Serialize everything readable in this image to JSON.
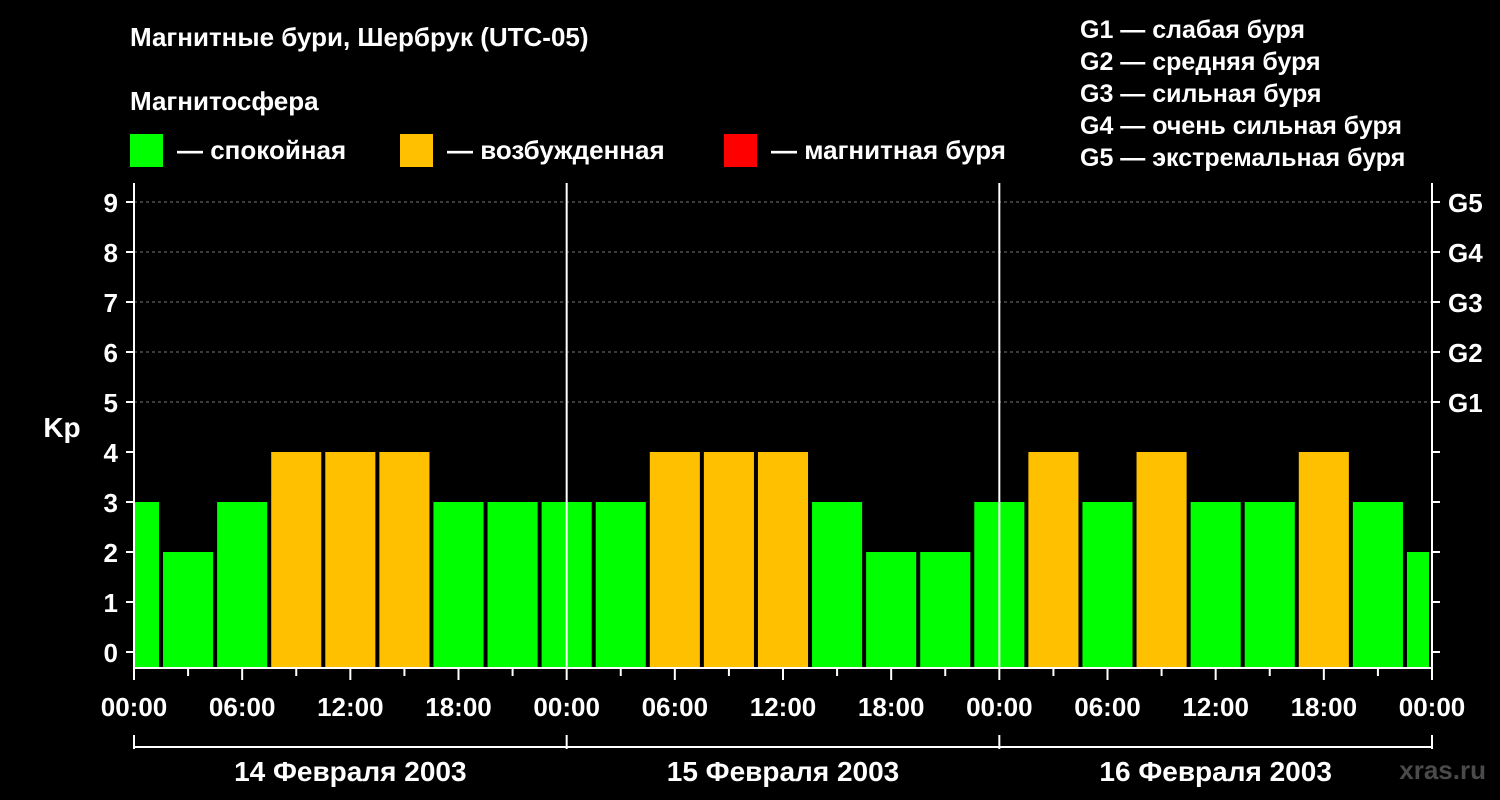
{
  "title": "Магнитные бури, Шербрук (UTC-05)",
  "magnetosphere": {
    "heading": "Магнитосфера",
    "legend": [
      {
        "label": "— спокойная",
        "color": "#00ff00"
      },
      {
        "label": "— возбужденная",
        "color": "#ffc000"
      },
      {
        "label": "— магнитная буря",
        "color": "#ff0000"
      }
    ]
  },
  "g_legend": [
    "G1 — слабая буря",
    "G2 — средняя буря",
    "G3 — сильная буря",
    "G4 — очень сильная буря",
    "G5 — экстремальная буря"
  ],
  "watermark": "xras.ru",
  "chart_data": {
    "type": "bar",
    "ylabel": "Kp",
    "ylim": [
      0,
      9
    ],
    "yticks": [
      "0",
      "1",
      "2",
      "3",
      "4",
      "5",
      "6",
      "7",
      "8",
      "9"
    ],
    "g_levels": [
      {
        "label": "G1",
        "kp": 5
      },
      {
        "label": "G2",
        "kp": 6
      },
      {
        "label": "G3",
        "kp": 7
      },
      {
        "label": "G4",
        "kp": 8
      },
      {
        "label": "G5",
        "kp": 9
      }
    ],
    "grid": true,
    "xticks": [
      "00:00",
      "06:00",
      "12:00",
      "18:00",
      "00:00",
      "06:00",
      "12:00",
      "18:00",
      "00:00",
      "06:00",
      "12:00",
      "18:00",
      "00:00"
    ],
    "days": [
      "14 Февраля 2003",
      "15 Февраля 2003",
      "16 Февраля 2003"
    ],
    "colors": {
      "quiet": "#00ff00",
      "active": "#ffc000",
      "storm": "#ff0000"
    },
    "values": [
      3,
      2,
      3,
      4,
      4,
      4,
      3,
      3,
      3,
      3,
      4,
      4,
      4,
      3,
      2,
      2,
      3,
      4,
      3,
      4,
      3,
      3,
      4,
      3,
      2
    ]
  }
}
